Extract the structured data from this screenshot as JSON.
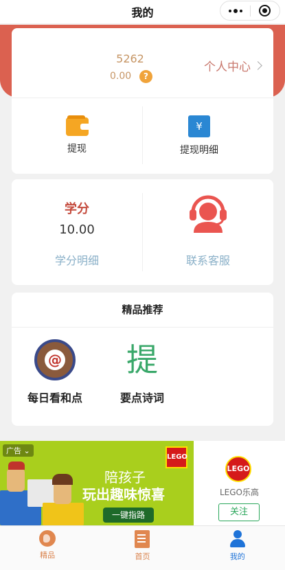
{
  "nav": {
    "title": "我的"
  },
  "user": {
    "points": "5262",
    "balance": "0.00",
    "help_badge": "?",
    "profile_link": "个人中心"
  },
  "actions": [
    {
      "label": "提现",
      "icon": "wallet-icon"
    },
    {
      "label": "提现明细",
      "icon": "yuan-receipt-icon",
      "glyph": "¥"
    }
  ],
  "score": {
    "title": "学分",
    "value": "10.00",
    "detail_label": "学分明细",
    "service_label": "联系客服",
    "service_icon": "customer-service-icon",
    "accent": "#c44a3c"
  },
  "recommend": {
    "title": "精品推荐",
    "items": [
      {
        "label": "每日看和点",
        "icon": "daily-read-icon",
        "glyph": "@"
      },
      {
        "label": "要点诗词",
        "icon": "poetry-icon",
        "glyph": "提"
      }
    ]
  },
  "ad": {
    "tag": "广告",
    "headline1": "陪孩子",
    "headline2": "玩出趣味惊喜",
    "button": "一键指路",
    "logo_text": "LEGO",
    "brand": "LEGO乐高",
    "follow": "关注"
  },
  "tabs": [
    {
      "label": "精品",
      "icon": "globe-icon"
    },
    {
      "label": "首页",
      "icon": "document-icon"
    },
    {
      "label": "我的",
      "icon": "user-icon",
      "active": true
    }
  ],
  "colors": {
    "header_red": "#db6150",
    "tab_active": "#1e73d8",
    "tab_inactive": "#d9814b"
  }
}
